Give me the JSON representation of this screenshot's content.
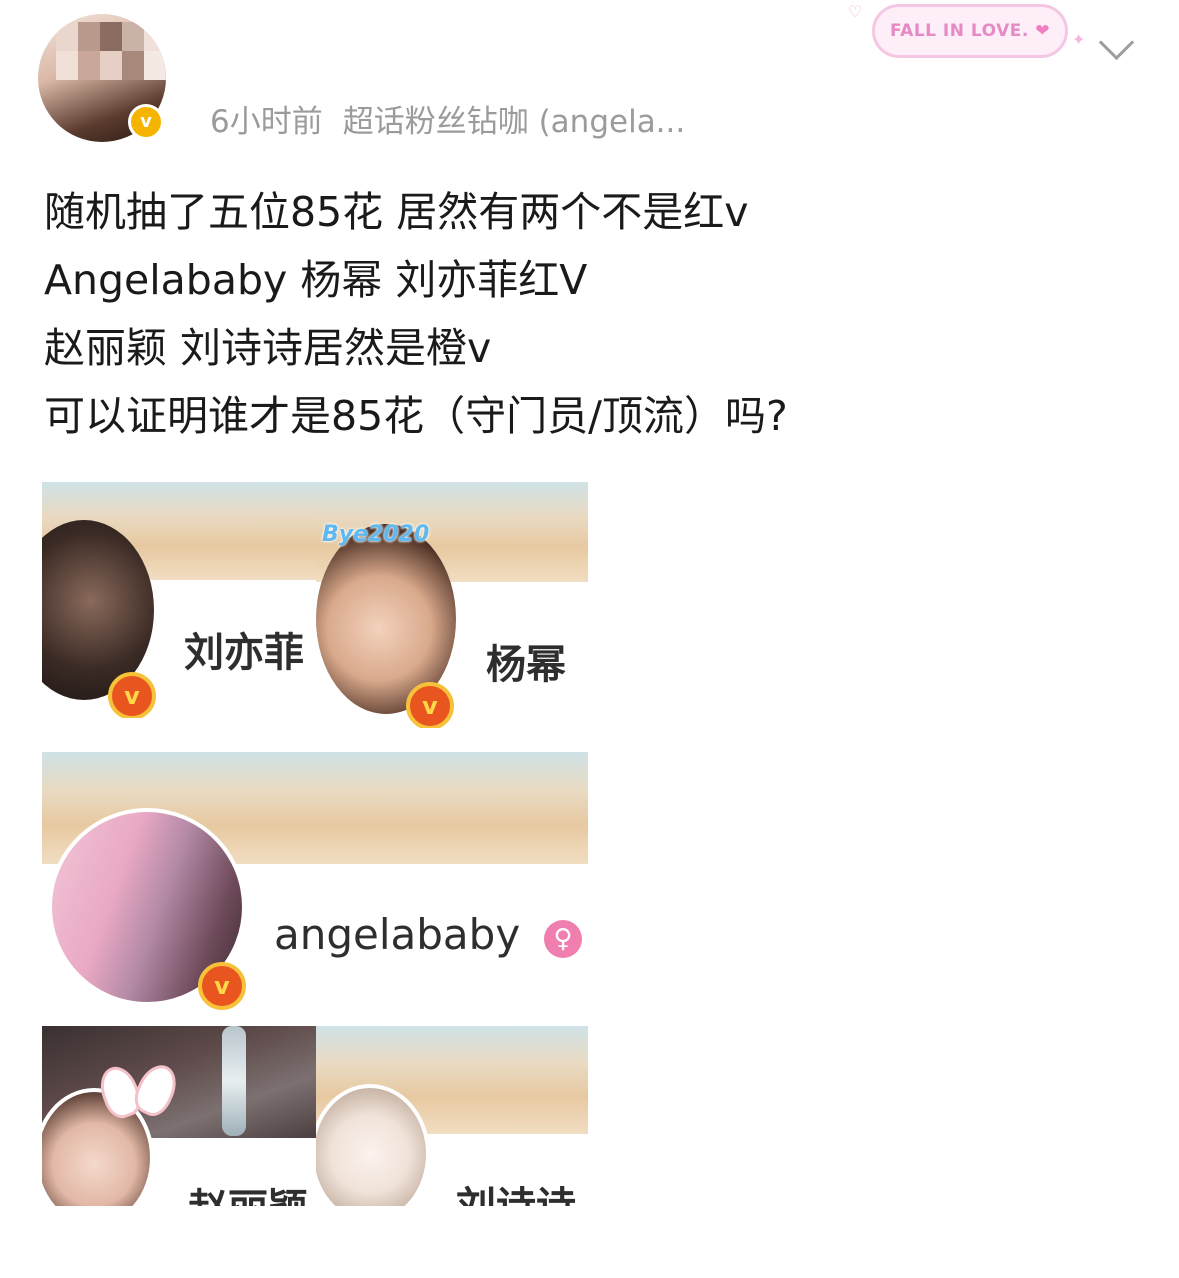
{
  "post": {
    "time": "6小时前",
    "source": "超话粉丝钻咖 (angela...",
    "lines": [
      "随机抽了五位85花 居然有两个不是红v",
      "Angelababy 杨幂 刘亦菲红V",
      "赵丽颖 刘诗诗居然是橙v",
      "可以证明谁才是85花（守门员/顶流）吗?"
    ]
  },
  "decoration": {
    "text": "FALL IN LOVE."
  },
  "badge": {
    "small": "v",
    "big": "v"
  },
  "cards": {
    "c1": {
      "name": "刘亦菲"
    },
    "c2": {
      "name": "杨幂",
      "sticker": "Bye2020"
    },
    "c3": {
      "name": "angelababy",
      "gender": "♀"
    },
    "c4": {
      "name": "赵丽颖"
    },
    "c5": {
      "name": "刘诗诗"
    }
  },
  "colors": {
    "meta_gray": "#9b9b9b",
    "vip_orange": "#e8551f",
    "badge_gold": "#f5b400"
  }
}
